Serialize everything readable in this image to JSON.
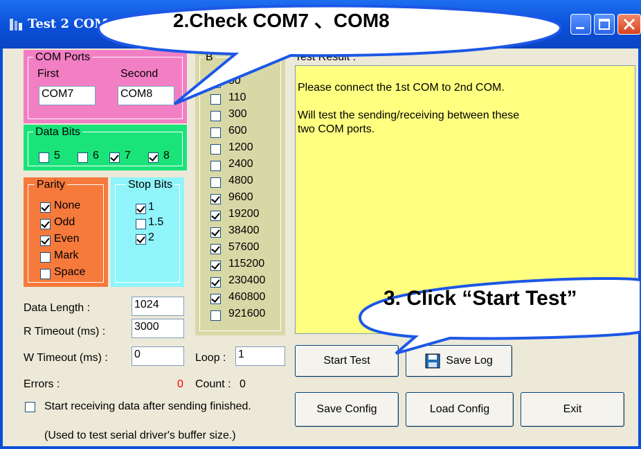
{
  "window": {
    "title": "Test 2 COM"
  },
  "callouts": {
    "check": "2.Check COM7 、COM8",
    "click": "3. Click “Start Test”"
  },
  "com_ports": {
    "legend": "COM Ports",
    "first_label": "First",
    "second_label": "Second",
    "first_value": "COM7",
    "second_value": "COM8"
  },
  "data_bits": {
    "legend": "Data Bits",
    "items": [
      {
        "label": "5",
        "checked": false
      },
      {
        "label": "6",
        "checked": false
      },
      {
        "label": "7",
        "checked": true
      },
      {
        "label": "8",
        "checked": true
      }
    ]
  },
  "parity": {
    "legend": "Parity",
    "items": [
      {
        "label": "None",
        "checked": true
      },
      {
        "label": "Odd",
        "checked": true
      },
      {
        "label": "Even",
        "checked": true
      },
      {
        "label": "Mark",
        "checked": false
      },
      {
        "label": "Space",
        "checked": false
      }
    ]
  },
  "stop_bits": {
    "legend": "Stop Bits",
    "items": [
      {
        "label": "1",
        "checked": true
      },
      {
        "label": "1.5",
        "checked": false
      },
      {
        "label": "2",
        "checked": true
      }
    ]
  },
  "baud": {
    "legend": "B",
    "items": [
      {
        "label": "50",
        "checked": false
      },
      {
        "label": "110",
        "checked": false
      },
      {
        "label": "300",
        "checked": false
      },
      {
        "label": "600",
        "checked": false
      },
      {
        "label": "1200",
        "checked": false
      },
      {
        "label": "2400",
        "checked": false
      },
      {
        "label": "4800",
        "checked": false
      },
      {
        "label": "9600",
        "checked": true
      },
      {
        "label": "19200",
        "checked": true
      },
      {
        "label": "38400",
        "checked": true
      },
      {
        "label": "57600",
        "checked": true
      },
      {
        "label": "115200",
        "checked": true
      },
      {
        "label": "230400",
        "checked": true
      },
      {
        "label": "460800",
        "checked": true
      },
      {
        "label": "921600",
        "checked": false
      }
    ]
  },
  "test_result": {
    "label": "Test Result :",
    "lines": [
      "Please connect the 1st COM to 2nd COM.",
      "",
      "Will test the sending/receiving between these",
      "two COM ports."
    ]
  },
  "params": {
    "data_length_label": "Data Length :",
    "data_length": "1024",
    "r_timeout_label": "R Timeout (ms) :",
    "r_timeout": "3000",
    "w_timeout_label": "W Timeout (ms) :",
    "w_timeout": "0",
    "loop_label": "Loop :",
    "loop": "1"
  },
  "status": {
    "errors_label": "Errors :",
    "errors_value": "0",
    "count_label": "Count :",
    "count_value": "0"
  },
  "options": {
    "start_after_label": "Start receiving data after sending finished.",
    "start_after_checked": false,
    "note": "(Used to test serial driver's buffer size.)"
  },
  "buttons": {
    "start_test": "Start Test",
    "save_log": "Save Log",
    "save_config": "Save Config",
    "load_config": "Load Config",
    "exit": "Exit"
  },
  "colors": {
    "com_ports": "#f27fc4",
    "data_bits": "#1ae37a",
    "parity": "#f57a3c",
    "stop_bits": "#8ff5fa",
    "baud": "#d8d8a6",
    "result": "#ffff80",
    "errors": "#ff0000",
    "titlebar": "#0a4fd8",
    "callout_border": "#1c57e6"
  }
}
